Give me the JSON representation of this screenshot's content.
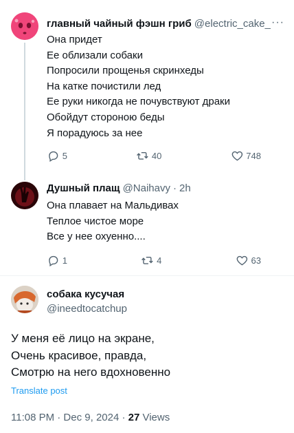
{
  "tweet1": {
    "name": "главный чайный фэшн гриб",
    "handle": "@electric_cake_",
    "more": "···",
    "lines": [
      "Она придет",
      "Ее облизали собаки",
      "Попросили прощенья скринхеды",
      "На катке почистили лед",
      "Ее руки никогда не почувствуют драки",
      "Обойдут стороною беды",
      "Я порадуюсь за нее"
    ],
    "replies": "5",
    "retweets": "40",
    "likes": "748"
  },
  "tweet2": {
    "name": "Душный плащ",
    "handle": "@Naihavy",
    "time": "2h",
    "lines": [
      "Она плавает на Мальдивах",
      "Теплое чистое море",
      "Все у нее охуенно...."
    ],
    "replies": "1",
    "retweets": "4",
    "likes": "63"
  },
  "main": {
    "name": "собака кусучая",
    "handle": "@ineedtocatchup",
    "lines": [
      "У меня её лицо на экране,",
      "Очень красивое, правда,",
      "Смотрю на него вдохновенно"
    ],
    "translate": "Translate post",
    "timestamp": "11:08 PM · Dec 9, 2024 · ",
    "views_count": "27",
    "views_label": " Views"
  },
  "colors": {
    "text": "#0f1419",
    "muted": "#536471",
    "link": "#1d9bf0",
    "avatar1": "#f0457a",
    "avatar2": "#3a0a10"
  }
}
